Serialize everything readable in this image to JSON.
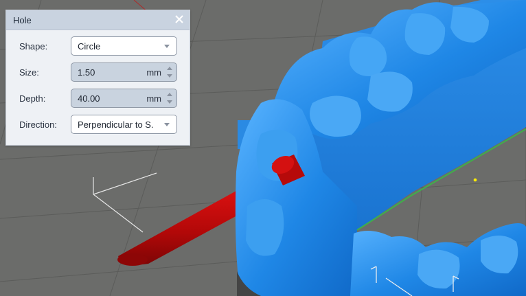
{
  "panel": {
    "title": "Hole",
    "close_icon": "close-icon"
  },
  "fields": {
    "shape": {
      "label": "Shape:",
      "value": "Circle"
    },
    "size": {
      "label": "Size:",
      "value": "1.50",
      "unit": "mm"
    },
    "depth": {
      "label": "Depth:",
      "value": "40.00",
      "unit": "mm"
    },
    "direction": {
      "label": "Direction:",
      "value": "Perpendicular to S."
    }
  },
  "colors": {
    "viewport_bg": "#6b6c6a",
    "grid": "#5d5e5c",
    "model": "#2f8fe0",
    "hole_cylinder": "#c40a0a",
    "panel_bg": "#eef1f5",
    "panel_header": "#c9d3e0"
  }
}
